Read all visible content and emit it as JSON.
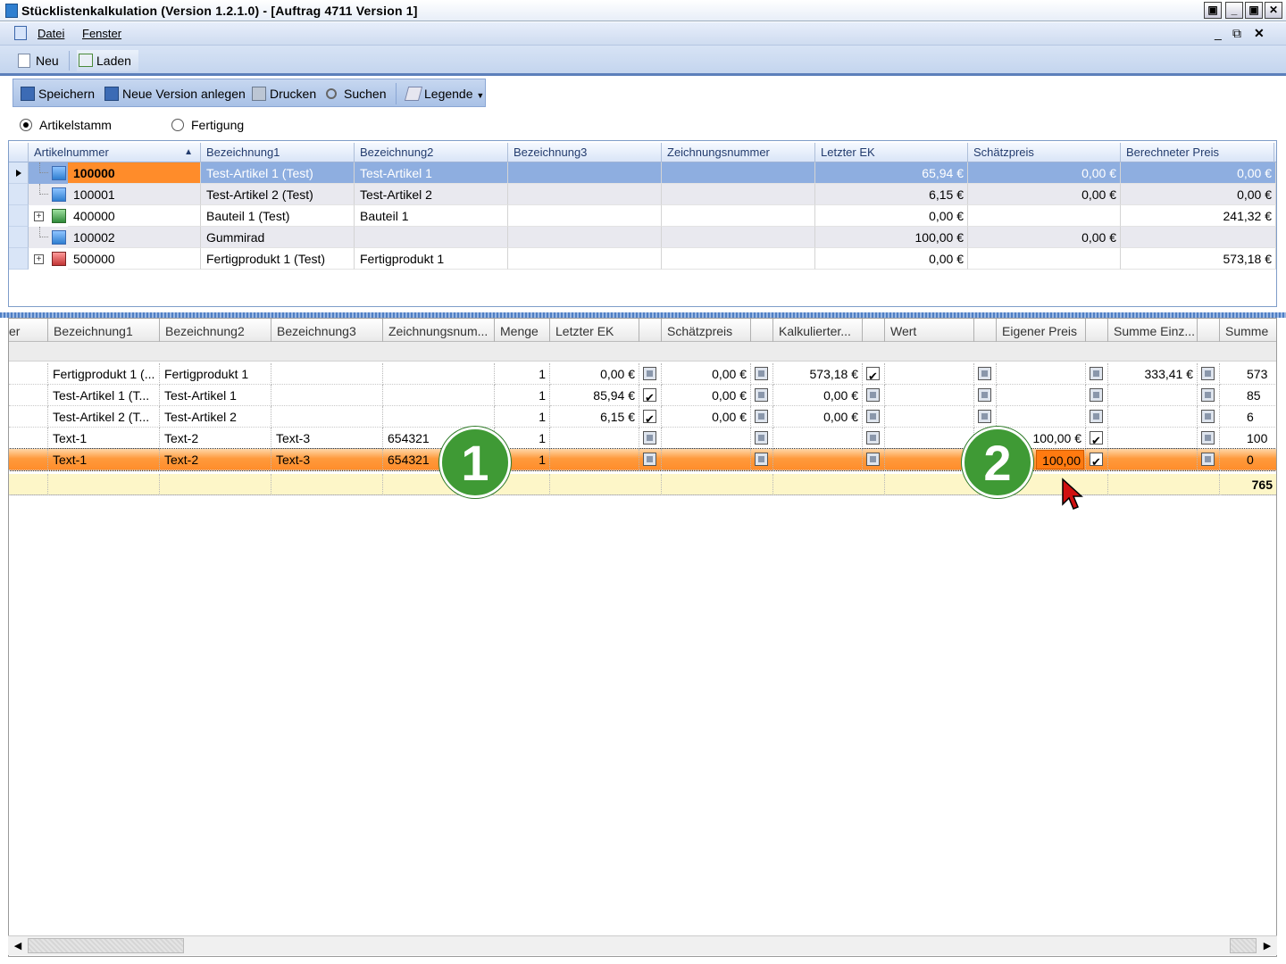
{
  "window": {
    "title": "Stücklistenkalkulation (Version 1.2.1.0) - [Auftrag 4711 Version 1]"
  },
  "menu": {
    "items": [
      "Datei",
      "Fenster"
    ]
  },
  "tabs": {
    "neu": "Neu",
    "laden": "Laden"
  },
  "toolbar": {
    "save": "Speichern",
    "new_version": "Neue Version anlegen",
    "print": "Drucken",
    "search": "Suchen",
    "legend": "Legende"
  },
  "mode": {
    "option1": "Artikelstamm",
    "option2": "Fertigung",
    "selected": "Artikelstamm"
  },
  "upper_grid": {
    "headers": [
      "Artikelnummer",
      "Bezeichnung1",
      "Bezeichnung2",
      "Bezeichnung3",
      "Zeichnungsnummer",
      "Letzter EK",
      "Schätzpreis",
      "Berechneter Preis"
    ],
    "rows": [
      {
        "nr": "100000",
        "b1": "Test-Artikel 1  (Test)",
        "b2": "Test-Artikel 1",
        "b3": "",
        "z": "",
        "ek": "65,94 €",
        "sp": "0,00 €",
        "bp": "0,00 €"
      },
      {
        "nr": "100001",
        "b1": "Test-Artikel 2  (Test)",
        "b2": "Test-Artikel 2",
        "b3": "",
        "z": "",
        "ek": "6,15 €",
        "sp": "0,00 €",
        "bp": "0,00 €"
      },
      {
        "nr": "400000",
        "b1": "Bauteil 1  (Test)",
        "b2": "Bauteil 1",
        "b3": "",
        "z": "",
        "ek": "0,00 €",
        "sp": "",
        "bp": "241,32 €"
      },
      {
        "nr": "100002",
        "b1": "Gummirad",
        "b2": "",
        "b3": "",
        "z": "",
        "ek": "100,00 €",
        "sp": "0,00 €",
        "bp": ""
      },
      {
        "nr": "500000",
        "b1": "Fertigprodukt 1  (Test)",
        "b2": "Fertigprodukt 1",
        "b3": "",
        "z": "",
        "ek": "0,00 €",
        "sp": "",
        "bp": "573,18 €"
      }
    ]
  },
  "lower_grid": {
    "headers": [
      "er",
      "Bezeichnung1",
      "Bezeichnung2",
      "Bezeichnung3",
      "Zeichnungsnum...",
      "Menge",
      "Letzter EK",
      "",
      "Schätzpreis",
      "",
      "Kalkulierter...",
      "",
      "Wert",
      "",
      "Eigener Preis",
      "",
      "Summe Einz...",
      "",
      "Summe"
    ],
    "rows": [
      {
        "b1": "Fertigprodukt 1  (...",
        "b2": "Fertigprodukt 1",
        "b3": "",
        "z": "",
        "m": "1",
        "ek": "0,00 €",
        "sp": "0,00 €",
        "kp": "573,18 €",
        "w": "",
        "ep": "",
        "se": "333,41 €",
        "s": "573"
      },
      {
        "b1": "Test-Artikel 1  (T...",
        "b2": "Test-Artikel 1",
        "b3": "",
        "z": "",
        "m": "1",
        "ek": "85,94 €",
        "sp": "0,00 €",
        "kp": "0,00 €",
        "w": "",
        "ep": "",
        "se": "",
        "s": "85"
      },
      {
        "b1": "Test-Artikel 2  (T...",
        "b2": "Test-Artikel 2",
        "b3": "",
        "z": "",
        "m": "1",
        "ek": "6,15 €",
        "sp": "0,00 €",
        "kp": "0,00 €",
        "w": "",
        "ep": "",
        "se": "",
        "s": "6"
      },
      {
        "b1": "Text-1",
        "b2": "Text-2",
        "b3": "Text-3",
        "z": "654321",
        "m": "1",
        "ek": "",
        "sp": "",
        "kp": "",
        "w": "",
        "ep": "100,00 €",
        "se": "",
        "s": "100"
      },
      {
        "b1": "Text-1",
        "b2": "Text-2",
        "b3": "Text-3",
        "z": "654321",
        "m": "1",
        "ek": "",
        "sp": "",
        "kp": "",
        "w": "",
        "ep": "100,00",
        "se": "",
        "s": "0"
      }
    ],
    "total": "765"
  },
  "callouts": {
    "one": "1",
    "two": "2"
  },
  "colors": {
    "selection_orange": "#ff8c2a",
    "callout_green": "#3f9a35",
    "upper_selection_blue": "#8eaee0"
  }
}
